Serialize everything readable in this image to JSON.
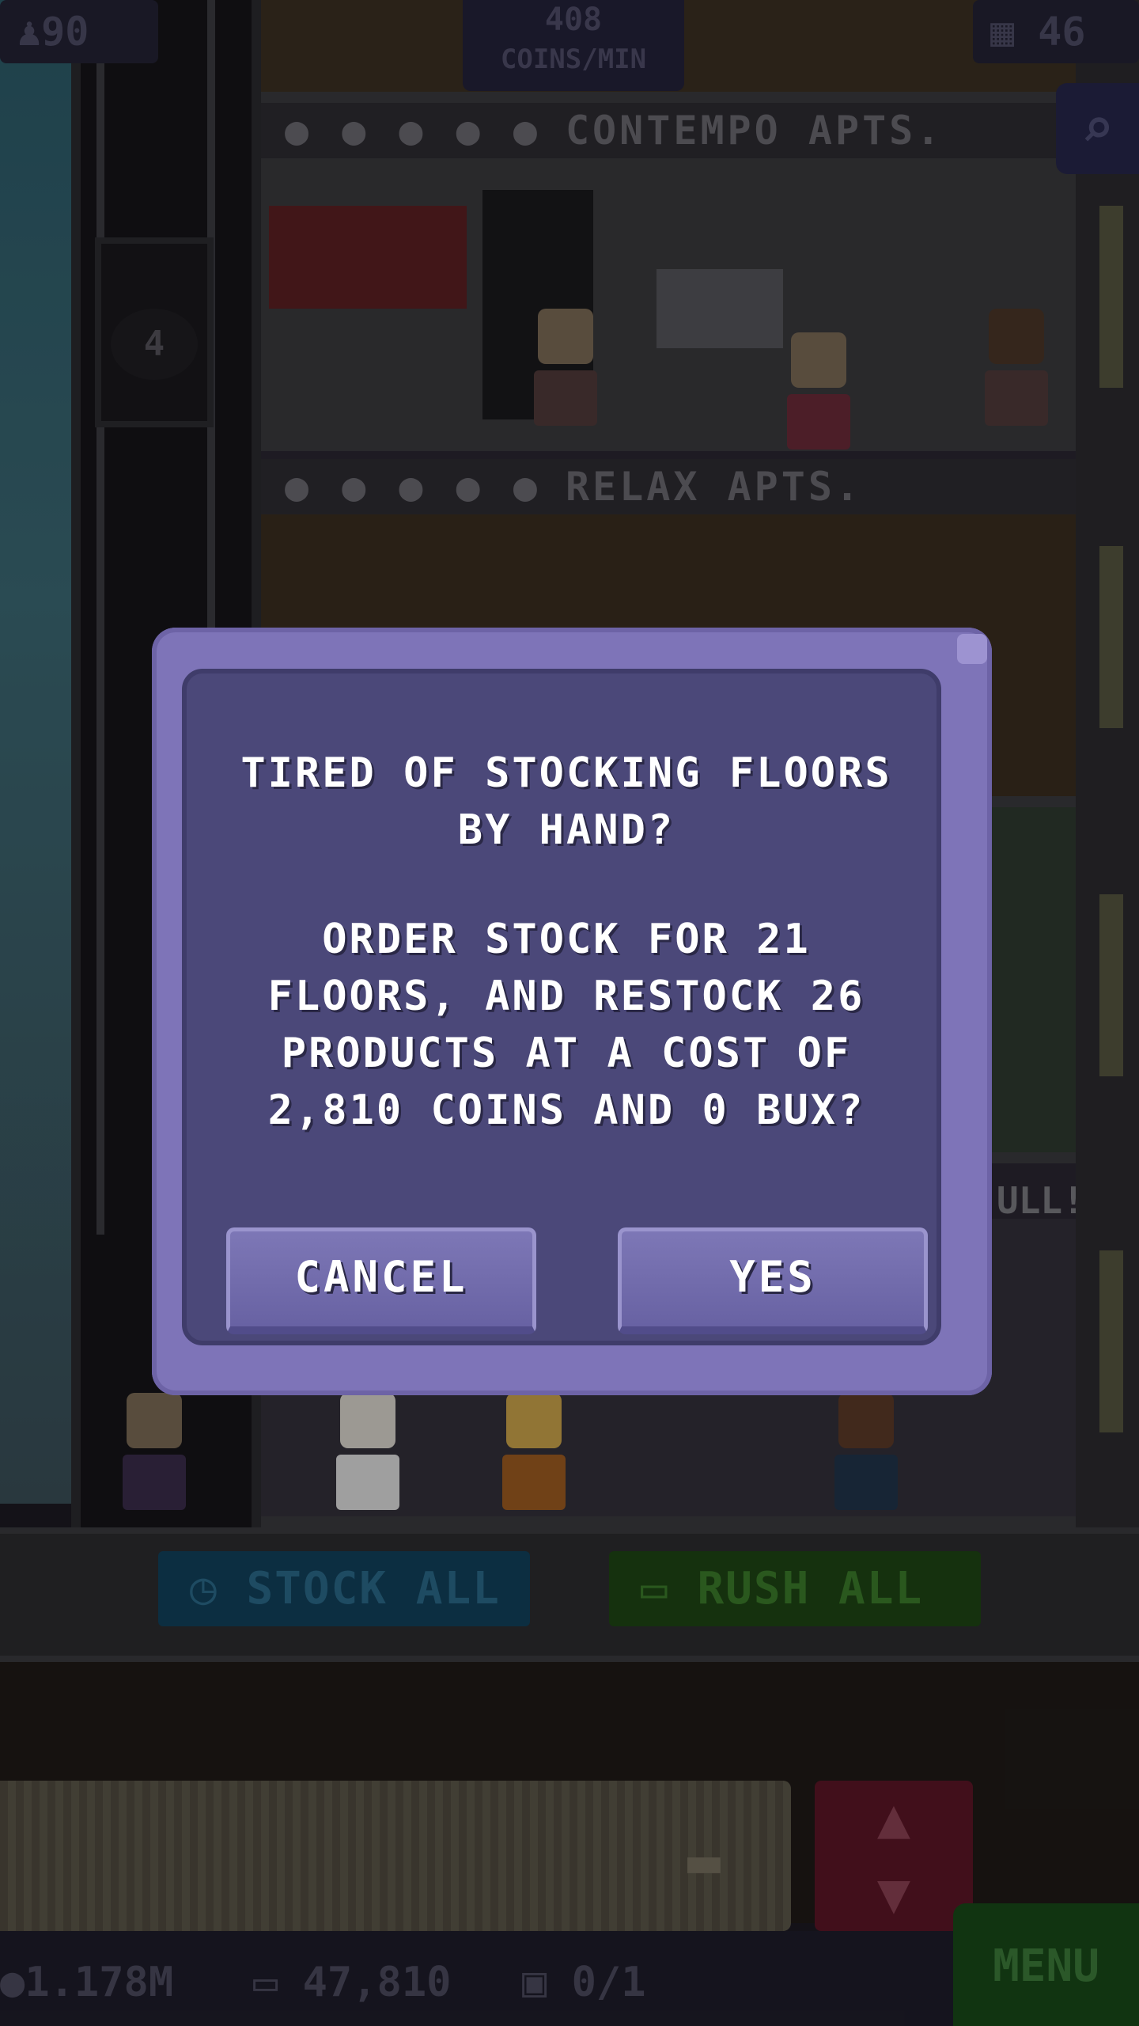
{
  "hud": {
    "residents": "90",
    "coins_per_min_value": "408",
    "coins_per_min_label": "COINS/MIN",
    "floors_count": "46"
  },
  "floors": {
    "contempo_label": "CONTEMPO APTS.",
    "relax_label": "RELAX APTS.",
    "elevator_floor_indicator": "4",
    "partial_sign": "ULL!"
  },
  "lobby": {
    "stock_all_label": "STOCK ALL",
    "rush_all_label": "RUSH ALL"
  },
  "bottom_bar": {
    "coins": "1.178M",
    "bux": "47,810",
    "tickets": "0/1",
    "menu_label": "MENU"
  },
  "dialog": {
    "title_line1": "TIRED OF STOCKING FLOORS",
    "title_line2": "BY HAND?",
    "body_line1": "ORDER STOCK FOR 21",
    "body_line2": "FLOORS, AND RESTOCK 26",
    "body_line3": "PRODUCTS AT A COST OF",
    "body_line4": "2,810 COINS AND 0 BUX?",
    "cancel_label": "CANCEL",
    "yes_label": "YES"
  },
  "colors": {
    "dialog_outer": "#7e74b8",
    "dialog_inner": "#4b4879",
    "button": "#6f69aa",
    "stock_button": "#11405a",
    "rush_button": "#1e4514",
    "menu_button": "#184818"
  }
}
